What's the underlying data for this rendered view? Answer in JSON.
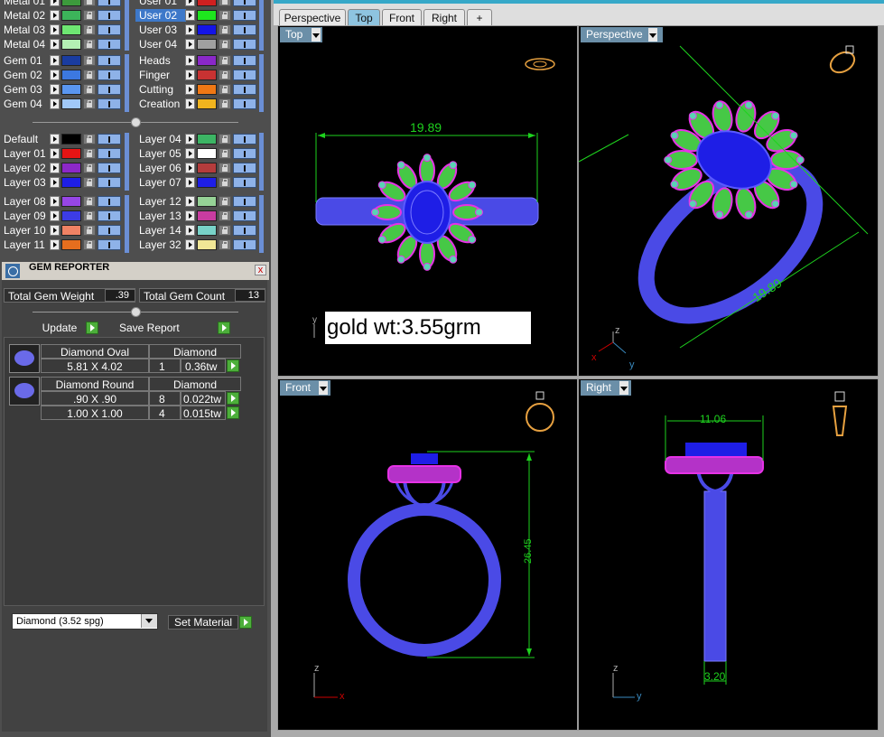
{
  "layers": {
    "metal_left": [
      {
        "name": "Metal 01",
        "color": "#3c9a3c"
      },
      {
        "name": "Metal 02",
        "color": "#3cb45a"
      },
      {
        "name": "Metal 03",
        "color": "#6ee672"
      },
      {
        "name": "Metal 04",
        "color": "#b4f0b4"
      }
    ],
    "user_right": [
      {
        "name": "User 01",
        "color": "#d02020",
        "selected": false
      },
      {
        "name": "User 02",
        "color": "#1ee61e",
        "selected": true
      },
      {
        "name": "User 03",
        "color": "#1414e6",
        "selected": false
      },
      {
        "name": "User 04",
        "color": "#a0a0a0",
        "selected": false
      }
    ],
    "gem_left": [
      {
        "name": "Gem 01",
        "color": "#1a3ca0"
      },
      {
        "name": "Gem 02",
        "color": "#3c78e0"
      },
      {
        "name": "Gem 03",
        "color": "#5a96f0"
      },
      {
        "name": "Gem 04",
        "color": "#a0c8f8"
      }
    ],
    "misc_right": [
      {
        "name": "Heads",
        "color": "#8a28c8"
      },
      {
        "name": "Finger",
        "color": "#c83232"
      },
      {
        "name": "Cutting",
        "color": "#f07814"
      },
      {
        "name": "Creation",
        "color": "#f0b41e"
      }
    ],
    "group_a_left": [
      {
        "name": "Default",
        "color": "#000000"
      },
      {
        "name": "Layer 01",
        "color": "#e61414"
      },
      {
        "name": "Layer 02",
        "color": "#8c28c8"
      },
      {
        "name": "Layer 03",
        "color": "#1e1ee6"
      }
    ],
    "group_a_right": [
      {
        "name": "Layer 04",
        "color": "#3cb464"
      },
      {
        "name": "Layer 05",
        "color": "#ffffff"
      },
      {
        "name": "Layer 06",
        "color": "#b43c3c"
      },
      {
        "name": "Layer 07",
        "color": "#1e1ee6"
      }
    ],
    "group_b_left": [
      {
        "name": "Layer 08",
        "color": "#9646e6"
      },
      {
        "name": "Layer 09",
        "color": "#3c3ce6"
      },
      {
        "name": "Layer 10",
        "color": "#f08264"
      },
      {
        "name": "Layer 11",
        "color": "#e66e1e"
      }
    ],
    "group_b_right": [
      {
        "name": "Layer 12",
        "color": "#96d296"
      },
      {
        "name": "Layer 13",
        "color": "#c83ca0"
      },
      {
        "name": "Layer 14",
        "color": "#78d2c8"
      },
      {
        "name": "Layer 32",
        "color": "#f0e696"
      }
    ]
  },
  "gem_reporter": {
    "title": "GEM REPORTER",
    "close": "x",
    "total_weight_label": "Total Gem Weight",
    "total_weight_value": ".39",
    "total_count_label": "Total Gem Count",
    "total_count_value": "13",
    "update_label": "Update",
    "save_label": "Save Report",
    "entries": [
      {
        "name": "Diamond Oval",
        "material": "Diamond",
        "rows": [
          {
            "size": "5.81 X 4.02",
            "count": "1",
            "weight": "0.36tw"
          }
        ]
      },
      {
        "name": "Diamond Round",
        "material": "Diamond",
        "rows": [
          {
            "size": ".90 X .90",
            "count": "8",
            "weight": "0.022tw"
          },
          {
            "size": "1.00 X 1.00",
            "count": "4",
            "weight": "0.015tw"
          }
        ]
      }
    ],
    "material_select": "Diamond      (3.52 spg)",
    "set_material_label": "Set Material"
  },
  "tabs": [
    {
      "label": "Perspective",
      "active": false
    },
    {
      "label": "Top",
      "active": true
    },
    {
      "label": "Front",
      "active": false
    },
    {
      "label": "Right",
      "active": false
    },
    {
      "label": "+",
      "active": false
    }
  ],
  "viewports": {
    "top": {
      "label": "Top",
      "dimension": "19.89",
      "note": "gold wt:3.55grm",
      "axis_y": "y"
    },
    "perspective": {
      "label": "Perspective",
      "dimension": "19.89",
      "axis_x": "x",
      "axis_y": "y",
      "axis_z": "z"
    },
    "front": {
      "label": "Front",
      "dimension": "26.45",
      "axis_x": "x",
      "axis_z": "z"
    },
    "right": {
      "label": "Right",
      "dimension_top": "11.06",
      "dimension_bottom": "3.20",
      "axis_y": "y",
      "axis_z": "z"
    }
  },
  "colors": {
    "ring_blue": "#4a4ae6",
    "prong_magenta": "#e632e6",
    "gem_green": "#46c846",
    "dim_green": "#1ed21e",
    "orange_icon": "#e6a040"
  }
}
